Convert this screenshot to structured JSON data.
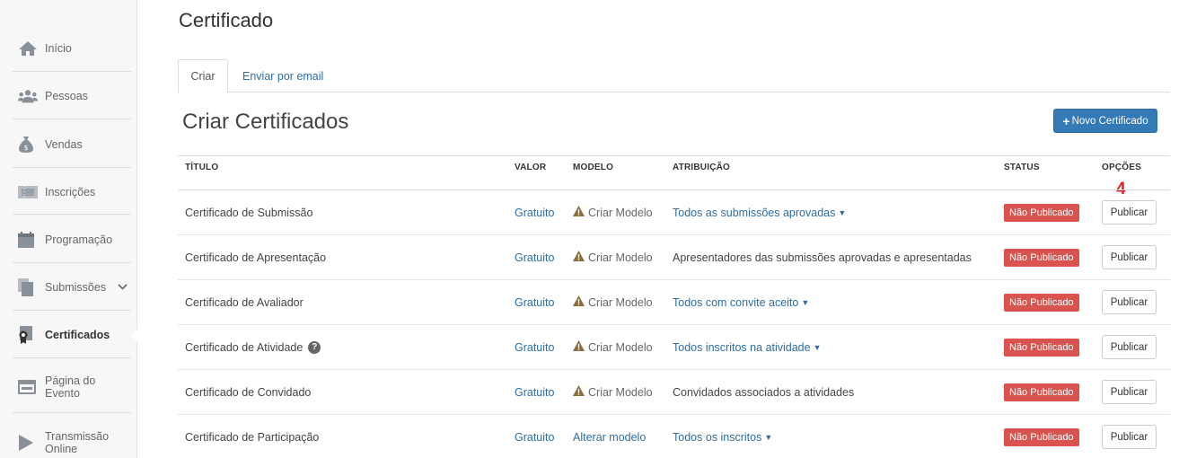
{
  "sidebar": {
    "items": [
      {
        "label": "Início",
        "icon": "home-icon"
      },
      {
        "label": "Pessoas",
        "icon": "people-icon"
      },
      {
        "label": "Vendas",
        "icon": "money-bag-icon"
      },
      {
        "label": "Inscrições",
        "icon": "ticket-icon"
      },
      {
        "label": "Programação",
        "icon": "calendar-icon"
      },
      {
        "label": "Submissões",
        "icon": "documents-icon"
      },
      {
        "label": "Certificados",
        "icon": "certificate-icon"
      },
      {
        "label": "Página do Evento",
        "icon": "webpage-icon"
      },
      {
        "label": "Transmissão Online",
        "icon": "play-icon"
      }
    ]
  },
  "header": {
    "title": "Certificado"
  },
  "tabs": [
    {
      "label": "Criar"
    },
    {
      "label": "Enviar por email"
    }
  ],
  "main": {
    "section_title": "Criar Certificados",
    "new_button": "Novo Certificado",
    "step_marker": "4"
  },
  "table": {
    "columns": [
      "TÍTULO",
      "VALOR",
      "MODELO",
      "ATRIBUIÇÃO",
      "STATUS",
      "OPÇÕES"
    ],
    "rows": [
      {
        "title": "Certificado de Submissão",
        "valor": "Gratuito",
        "modelo": "Criar Modelo",
        "atribuicao": "Todos as submissões aprovadas",
        "status": "Não Publicado",
        "opcao": "Publicar"
      },
      {
        "title": "Certificado de Apresentação",
        "valor": "Gratuito",
        "modelo": "Criar Modelo",
        "atribuicao": "Apresentadores das submissões aprovadas e apresentadas",
        "status": "Não Publicado",
        "opcao": "Publicar"
      },
      {
        "title": "Certificado de Avaliador",
        "valor": "Gratuito",
        "modelo": "Criar Modelo",
        "atribuicao": "Todos com convite aceito",
        "status": "Não Publicado",
        "opcao": "Publicar"
      },
      {
        "title": "Certificado de Atividade",
        "valor": "Gratuito",
        "modelo": "Criar Modelo",
        "atribuicao": "Todos inscritos na atividade",
        "status": "Não Publicado",
        "opcao": "Publicar"
      },
      {
        "title": "Certificado de Convidado",
        "valor": "Gratuito",
        "modelo": "Criar Modelo",
        "atribuicao": "Convidados associados a atividades",
        "status": "Não Publicado",
        "opcao": "Publicar"
      },
      {
        "title": "Certificado de Participação",
        "valor": "Gratuito",
        "modelo": "Alterar modelo",
        "atribuicao": "Todos os inscritos",
        "status": "Não Publicado",
        "opcao": "Publicar"
      }
    ]
  },
  "colors": {
    "primary": "#337ab7",
    "link": "#2e6da4",
    "danger": "#d9534f",
    "warning_icon": "#8a6d3b",
    "marker": "#e02020"
  }
}
